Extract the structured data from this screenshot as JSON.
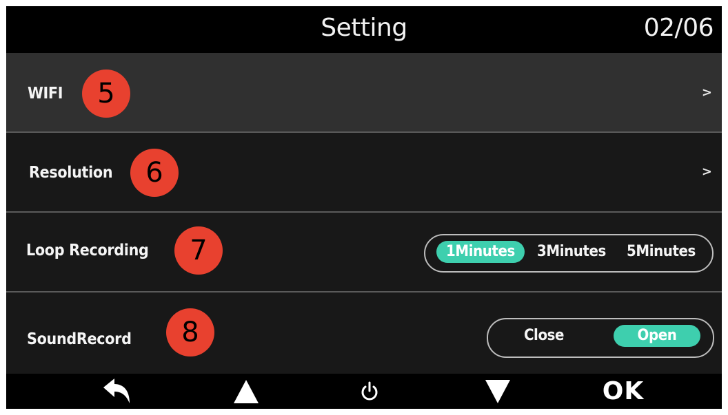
{
  "header": {
    "title": "Setting",
    "page_indicator": "02/06"
  },
  "menu": {
    "items": [
      {
        "label": "WIFI",
        "marker": "5",
        "type": "submenu",
        "chevron": ">"
      },
      {
        "label": "Resolution",
        "marker": "6",
        "type": "submenu",
        "chevron": ">"
      },
      {
        "label": "Loop Recording",
        "marker": "7",
        "type": "options",
        "options": [
          "1Minutes",
          "3Minutes",
          "5Minutes"
        ],
        "selected": "1Minutes"
      },
      {
        "label": "SoundRecord",
        "marker": "8",
        "type": "options",
        "options": [
          "Close",
          "Open"
        ],
        "selected": "Open"
      }
    ]
  },
  "footer": {
    "buttons": [
      {
        "name": "back",
        "icon": "back-arrow-icon"
      },
      {
        "name": "up",
        "icon": "up-triangle-icon"
      },
      {
        "name": "power",
        "icon": "power-icon"
      },
      {
        "name": "down",
        "icon": "down-triangle-icon"
      },
      {
        "name": "ok",
        "label": "OK"
      }
    ]
  },
  "colors": {
    "background": "#000000",
    "row": "#181818",
    "row_selected": "#303030",
    "accent": "#3ecfae",
    "marker": "#e8412f"
  }
}
